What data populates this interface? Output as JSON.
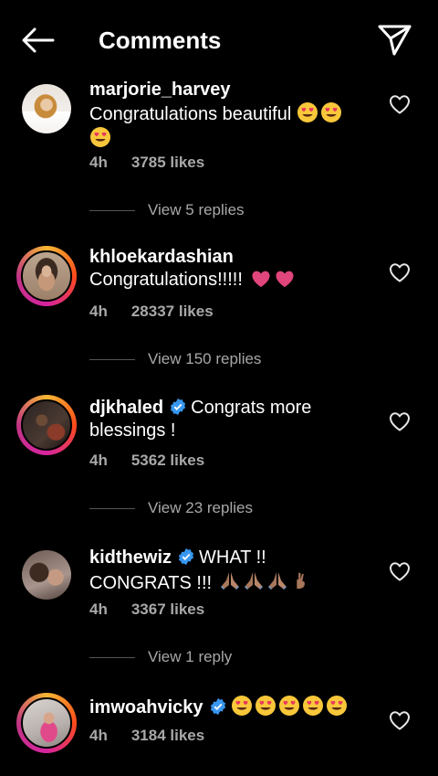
{
  "header": {
    "title": "Comments",
    "back_icon": "arrow-left-icon",
    "share_icon": "paper-plane-icon"
  },
  "colors": {
    "background": "#000000",
    "meta_text": "#a8a8a8",
    "verified": "#3897f0",
    "heart_emoji": "#e0457b"
  },
  "comments": [
    {
      "username": "marjorie_harvey",
      "verified": false,
      "text": "Congratulations beautiful",
      "emoji": "heart-eyes x3",
      "time": "4h",
      "likes": "3785 likes",
      "replies_label": "View 5 replies",
      "story_ring": false
    },
    {
      "username": "khloekardashian",
      "verified": false,
      "text": "Congratulations!!!!!",
      "emoji": "pink-hearts x2",
      "time": "4h",
      "likes": "28337 likes",
      "replies_label": "View 150 replies",
      "story_ring": true
    },
    {
      "username": "djkhaled",
      "verified": true,
      "text": "Congrats more blessings !",
      "emoji": "",
      "time": "4h",
      "likes": "5362 likes",
      "replies_label": "View 23 replies",
      "story_ring": true
    },
    {
      "username": "kidthewiz",
      "verified": true,
      "text": "WHAT !! CONGRATS !!!",
      "emoji": "praying-hands x3, crossed-fingers",
      "time": "4h",
      "likes": "3367 likes",
      "replies_label": "View 1 reply",
      "story_ring": false
    },
    {
      "username": "imwoahvicky",
      "verified": true,
      "text": "",
      "emoji": "heart-eyes x5",
      "time": "4h",
      "likes": "3184 likes",
      "replies_label": "",
      "story_ring": true
    }
  ]
}
